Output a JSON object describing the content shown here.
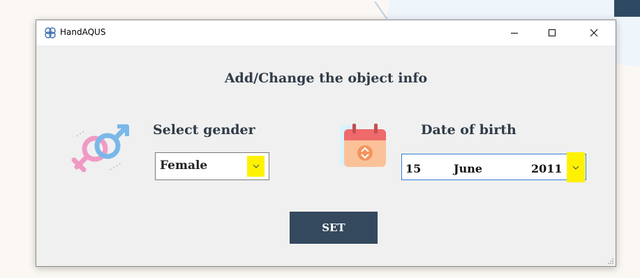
{
  "window": {
    "title": "HandAQUS",
    "controls": {
      "minimize": "—",
      "maximize": "☐",
      "close": "✕"
    }
  },
  "form": {
    "heading": "Add/Change the object info",
    "gender": {
      "label": "Select gender",
      "value": "Female",
      "icon": "gender-symbol-icon"
    },
    "dob": {
      "label": "Date of birth",
      "day": "15",
      "month": "June",
      "year": "2011",
      "icon": "calendar-icon"
    },
    "submit_label": "SET"
  },
  "colors": {
    "button_bg": "#34495e",
    "highlight": "#fff200",
    "focus_border": "#2f7dd6",
    "heading_text": "#2f3b47"
  }
}
